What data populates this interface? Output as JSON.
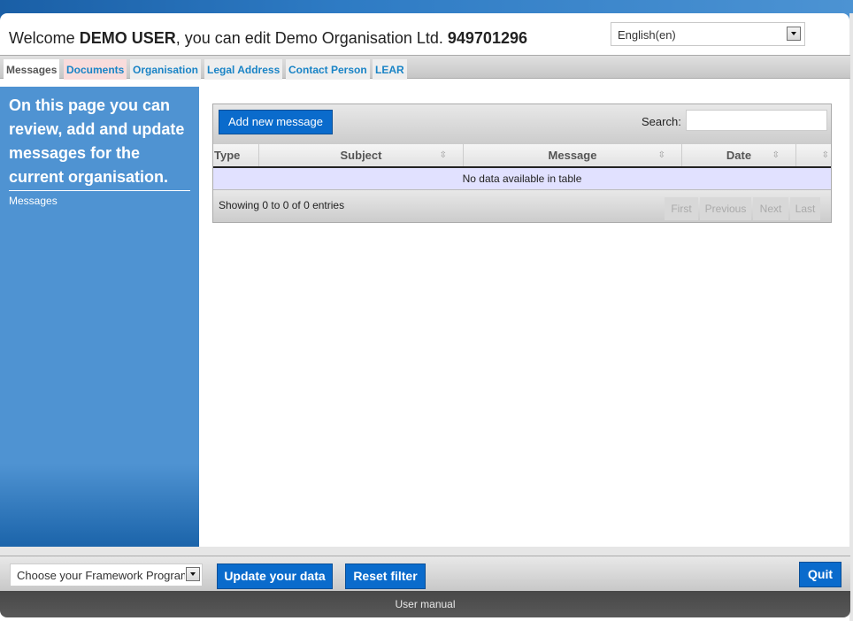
{
  "header": {
    "welcome_prefix": "Welcome ",
    "user_name": "DEMO USER",
    "welcome_middle": ", you can edit Demo Organisation Ltd. ",
    "org_id": "949701296",
    "language": {
      "selected": "English(en)",
      "icon": "chevron-down-icon"
    }
  },
  "tabs": [
    {
      "label": "Messages",
      "active": true
    },
    {
      "label": "Documents",
      "active": false,
      "highlight": "#f9dcdc"
    },
    {
      "label": "Organisation",
      "active": false
    },
    {
      "label": "Legal Address",
      "active": false
    },
    {
      "label": "Contact Person",
      "active": false
    },
    {
      "label": "LEAR",
      "active": false
    }
  ],
  "sidebar": {
    "intro": "On this page you can review, add and update messages for the current organisation.",
    "link": "Messages"
  },
  "table": {
    "add_button": "Add new message",
    "search_label": "Search:",
    "search_value": "",
    "columns": [
      {
        "label": "Type",
        "sortable": false
      },
      {
        "label": "Subject",
        "sortable": true
      },
      {
        "label": "Message",
        "sortable": true
      },
      {
        "label": "Date",
        "sortable": true
      },
      {
        "label": "",
        "sortable": true
      }
    ],
    "sort_icon": "⇳",
    "empty_text": "No data available in table",
    "info": "Showing 0 to 0 of 0 entries",
    "pagination": {
      "first": "First",
      "previous": "Previous",
      "next": "Next",
      "last": "Last"
    }
  },
  "footer": {
    "framework_select": "Choose your Framework Programme",
    "update_button": "Update your data",
    "reset_button": "Reset filter",
    "quit_button": "Quit",
    "user_manual": "User manual"
  },
  "colors": {
    "accent_blue": "#0a6bcc",
    "sidebar_blue": "#4f93d2",
    "tab_link": "#1a84c6",
    "empty_row": "#e1e1ff"
  }
}
